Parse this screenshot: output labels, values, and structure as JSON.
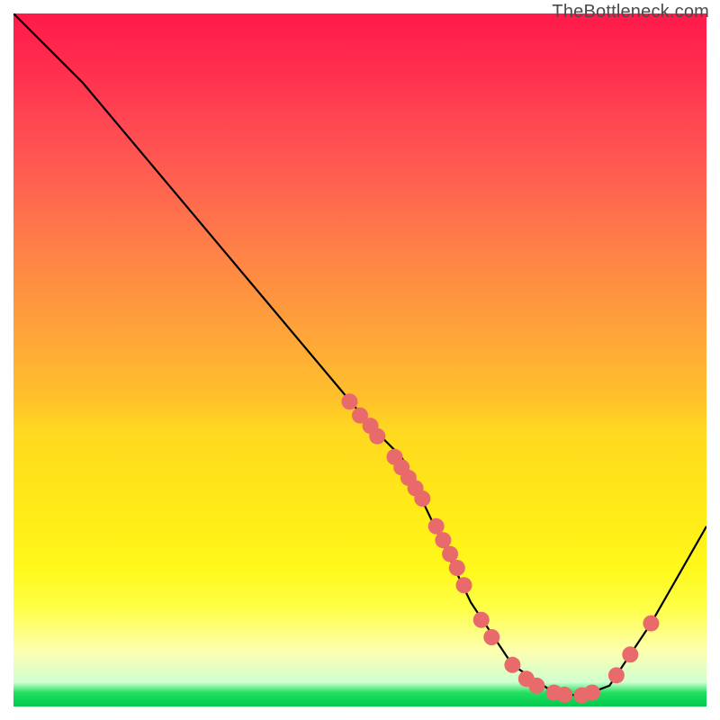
{
  "attribution": "TheBottleneck.com",
  "chart_data": {
    "type": "line",
    "title": "",
    "xlabel": "",
    "ylabel": "",
    "xlim": [
      0,
      100
    ],
    "ylim": [
      0,
      100
    ],
    "curve": [
      {
        "x": 0,
        "y": 100
      },
      {
        "x": 6,
        "y": 94
      },
      {
        "x": 10,
        "y": 90
      },
      {
        "x": 52,
        "y": 40
      },
      {
        "x": 56,
        "y": 36
      },
      {
        "x": 66,
        "y": 15
      },
      {
        "x": 72,
        "y": 6
      },
      {
        "x": 78,
        "y": 2
      },
      {
        "x": 82,
        "y": 1.5
      },
      {
        "x": 86,
        "y": 3
      },
      {
        "x": 92,
        "y": 12
      },
      {
        "x": 100,
        "y": 26
      }
    ],
    "markers": [
      {
        "x": 48.5,
        "y": 44
      },
      {
        "x": 50,
        "y": 42
      },
      {
        "x": 51.5,
        "y": 40.5
      },
      {
        "x": 52.5,
        "y": 39
      },
      {
        "x": 55,
        "y": 36
      },
      {
        "x": 56,
        "y": 34.5
      },
      {
        "x": 57,
        "y": 33
      },
      {
        "x": 58,
        "y": 31.5
      },
      {
        "x": 59,
        "y": 30
      },
      {
        "x": 61,
        "y": 26
      },
      {
        "x": 62,
        "y": 24
      },
      {
        "x": 63,
        "y": 22
      },
      {
        "x": 64,
        "y": 20
      },
      {
        "x": 65,
        "y": 17.5
      },
      {
        "x": 67.5,
        "y": 12.5
      },
      {
        "x": 69,
        "y": 10
      },
      {
        "x": 72,
        "y": 6
      },
      {
        "x": 74,
        "y": 4
      },
      {
        "x": 75.5,
        "y": 3
      },
      {
        "x": 78,
        "y": 2
      },
      {
        "x": 79.5,
        "y": 1.7
      },
      {
        "x": 82,
        "y": 1.6
      },
      {
        "x": 83.5,
        "y": 2
      },
      {
        "x": 87,
        "y": 4.5
      },
      {
        "x": 89,
        "y": 7.5
      },
      {
        "x": 92,
        "y": 12
      }
    ],
    "marker_color": "#e96a6a",
    "curve_color": "#000000"
  }
}
